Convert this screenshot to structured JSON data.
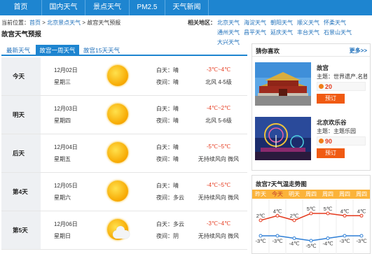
{
  "nav": {
    "items": [
      "首页",
      "国内天气",
      "景点天气",
      "PM2.5",
      "天气新闻"
    ]
  },
  "breadcrumb": {
    "prefix": "当前位置：",
    "home": "首页",
    "sep": ">",
    "parent": "北京景点天气",
    "current": "故宫天气预报"
  },
  "page_title": "故宫天气预报",
  "related": {
    "label": "相关地区：",
    "cities": [
      "北京天气",
      "海淀天气",
      "朝阳天气",
      "顺义天气",
      "怀柔天气",
      "通州天气",
      "昌平天气",
      "延庆天气",
      "丰台天气",
      "石景山天气",
      "大兴天气"
    ]
  },
  "forecast": {
    "tabs": [
      "最新天气",
      "故宫一周天气",
      "故宫15天天气"
    ],
    "active_tab": 1,
    "days": [
      {
        "label": "今天",
        "date": "12月02日",
        "weekday": "星期三",
        "icon": "sunny-icon",
        "day": "白天：晴",
        "night": "夜间：晴",
        "temp": "-3℃~4℃",
        "wind": "北风 4-5级"
      },
      {
        "label": "明天",
        "date": "12月03日",
        "weekday": "星期四",
        "icon": "sunny-icon",
        "day": "白天：晴",
        "night": "夜间：晴",
        "temp": "-4℃~2℃",
        "wind": "北风 5-6级"
      },
      {
        "label": "后天",
        "date": "12月04日",
        "weekday": "星期五",
        "icon": "sunny-icon",
        "day": "白天：晴",
        "night": "夜间：晴",
        "temp": "-5℃~5℃",
        "wind": "无持续风向 微风"
      },
      {
        "label": "第4天",
        "date": "12月05日",
        "weekday": "星期六",
        "icon": "sunny-icon",
        "day": "白天：晴",
        "night": "夜间：多云",
        "temp": "-4℃~5℃",
        "wind": "无持续风向 微风"
      },
      {
        "label": "第5天",
        "date": "12月06日",
        "weekday": "星期日",
        "icon": "partly-cloudy-icon",
        "day": "白天：多云",
        "night": "夜间：阴",
        "temp": "-3℃~4℃",
        "wind": "无持续风向 微风"
      }
    ]
  },
  "sidebar": {
    "title": "猜你喜欢",
    "more": "更多>>",
    "attractions": [
      {
        "name": "故宫",
        "theme": "主题：世界遗产,名胜古迹",
        "price": "20",
        "book": "预订",
        "pic": "forbidden-city-photo"
      },
      {
        "name": "北京欢乐谷",
        "theme": "主题：主题乐园",
        "price": "90",
        "book": "预订",
        "pic": "happy-valley-photo"
      }
    ]
  },
  "trend": {
    "title": "故宫7天气温走势图",
    "days": [
      "昨天",
      "今天",
      "明天",
      "周四",
      "周四",
      "周四",
      "周四"
    ],
    "today_index": 1,
    "high_labels": [
      "2℃",
      "4℃",
      "2℃",
      "5℃",
      "5℃",
      "4℃",
      "4℃"
    ],
    "low_labels": [
      "-3℃",
      "-3℃",
      "-4℃",
      "-5℃",
      "-4℃",
      "-3℃",
      "-3℃"
    ],
    "high_values": [
      2,
      4,
      2,
      5,
      5,
      4,
      4
    ],
    "low_values": [
      -3,
      -3,
      -4,
      -5,
      -4,
      -3,
      -3
    ],
    "colors": {
      "header": "#fbb33a",
      "high": "#e53a1e",
      "low": "#2f7fd6"
    }
  }
}
